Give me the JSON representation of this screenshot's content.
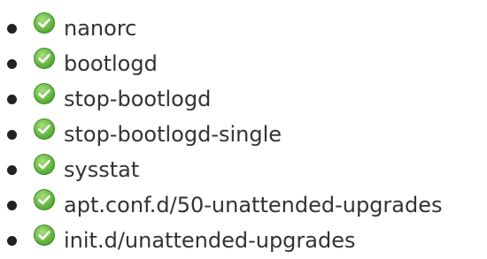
{
  "list": {
    "items": [
      {
        "label": "nanorc",
        "icon": "green-check-icon"
      },
      {
        "label": "bootlogd",
        "icon": "green-check-icon"
      },
      {
        "label": "stop-bootlogd",
        "icon": "green-check-icon"
      },
      {
        "label": "stop-bootlogd-single",
        "icon": "green-check-icon"
      },
      {
        "label": "sysstat",
        "icon": "green-check-icon"
      },
      {
        "label": "apt.conf.d/50-unattended-upgrades",
        "icon": "green-check-icon"
      },
      {
        "label": "init.d/unattended-upgrades",
        "icon": "green-check-icon"
      }
    ]
  },
  "colors": {
    "text": "#333333",
    "bullet": "#222222",
    "check_green": "#6cc04a"
  }
}
